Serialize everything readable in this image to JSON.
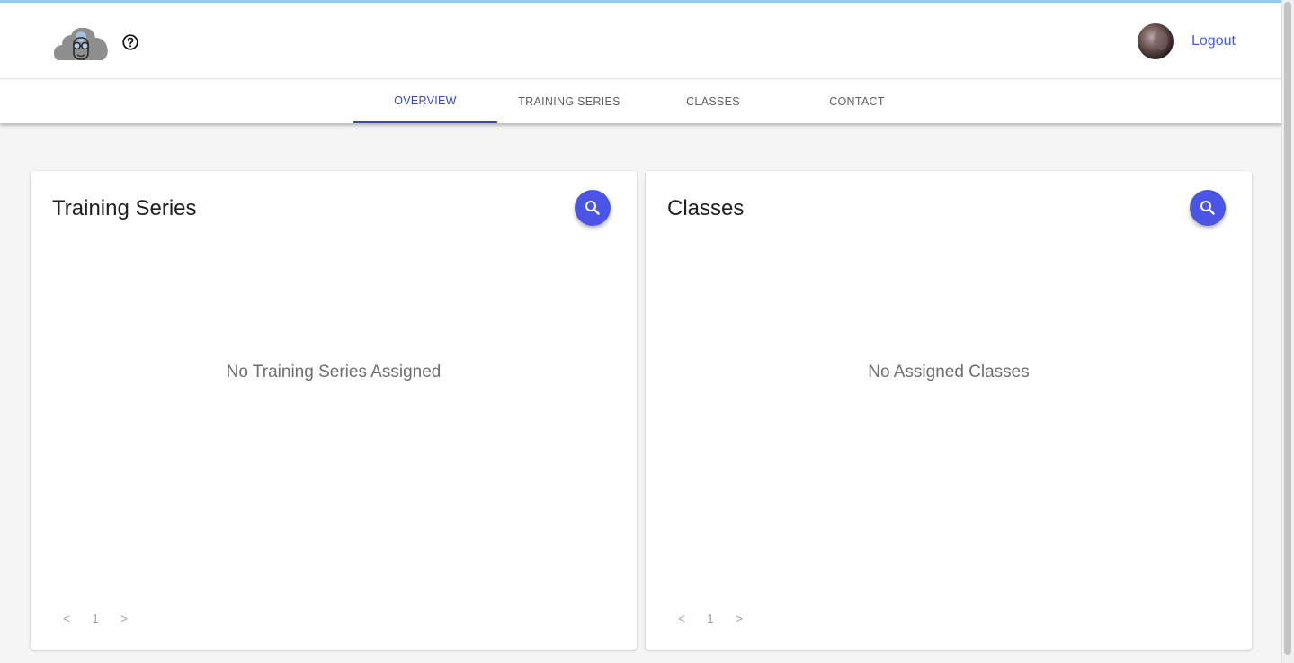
{
  "header": {
    "logo_icon": "cloud-glasses-logo-icon",
    "help_icon": "question-circle-icon",
    "avatar_icon": "user-avatar",
    "logout_label": "Logout",
    "logout_color": "#3d5afe"
  },
  "tabs": [
    {
      "label": "OVERVIEW",
      "active": true
    },
    {
      "label": "TRAINING SERIES",
      "active": false
    },
    {
      "label": "CLASSES",
      "active": false
    },
    {
      "label": "CONTACT",
      "active": false
    }
  ],
  "cards": {
    "training": {
      "title": "Training Series",
      "empty_message": "No Training Series Assigned",
      "search_icon": "search-icon",
      "pager": {
        "prev": "<",
        "page": "1",
        "next": ">"
      }
    },
    "classes": {
      "title": "Classes",
      "empty_message": "No Assigned Classes",
      "search_icon": "search-icon",
      "pager": {
        "prev": "<",
        "page": "1",
        "next": ">"
      }
    }
  },
  "colors": {
    "accent_bar": "#90caf9",
    "active_tab": "#3949ab",
    "fab": "#4a55e8"
  }
}
